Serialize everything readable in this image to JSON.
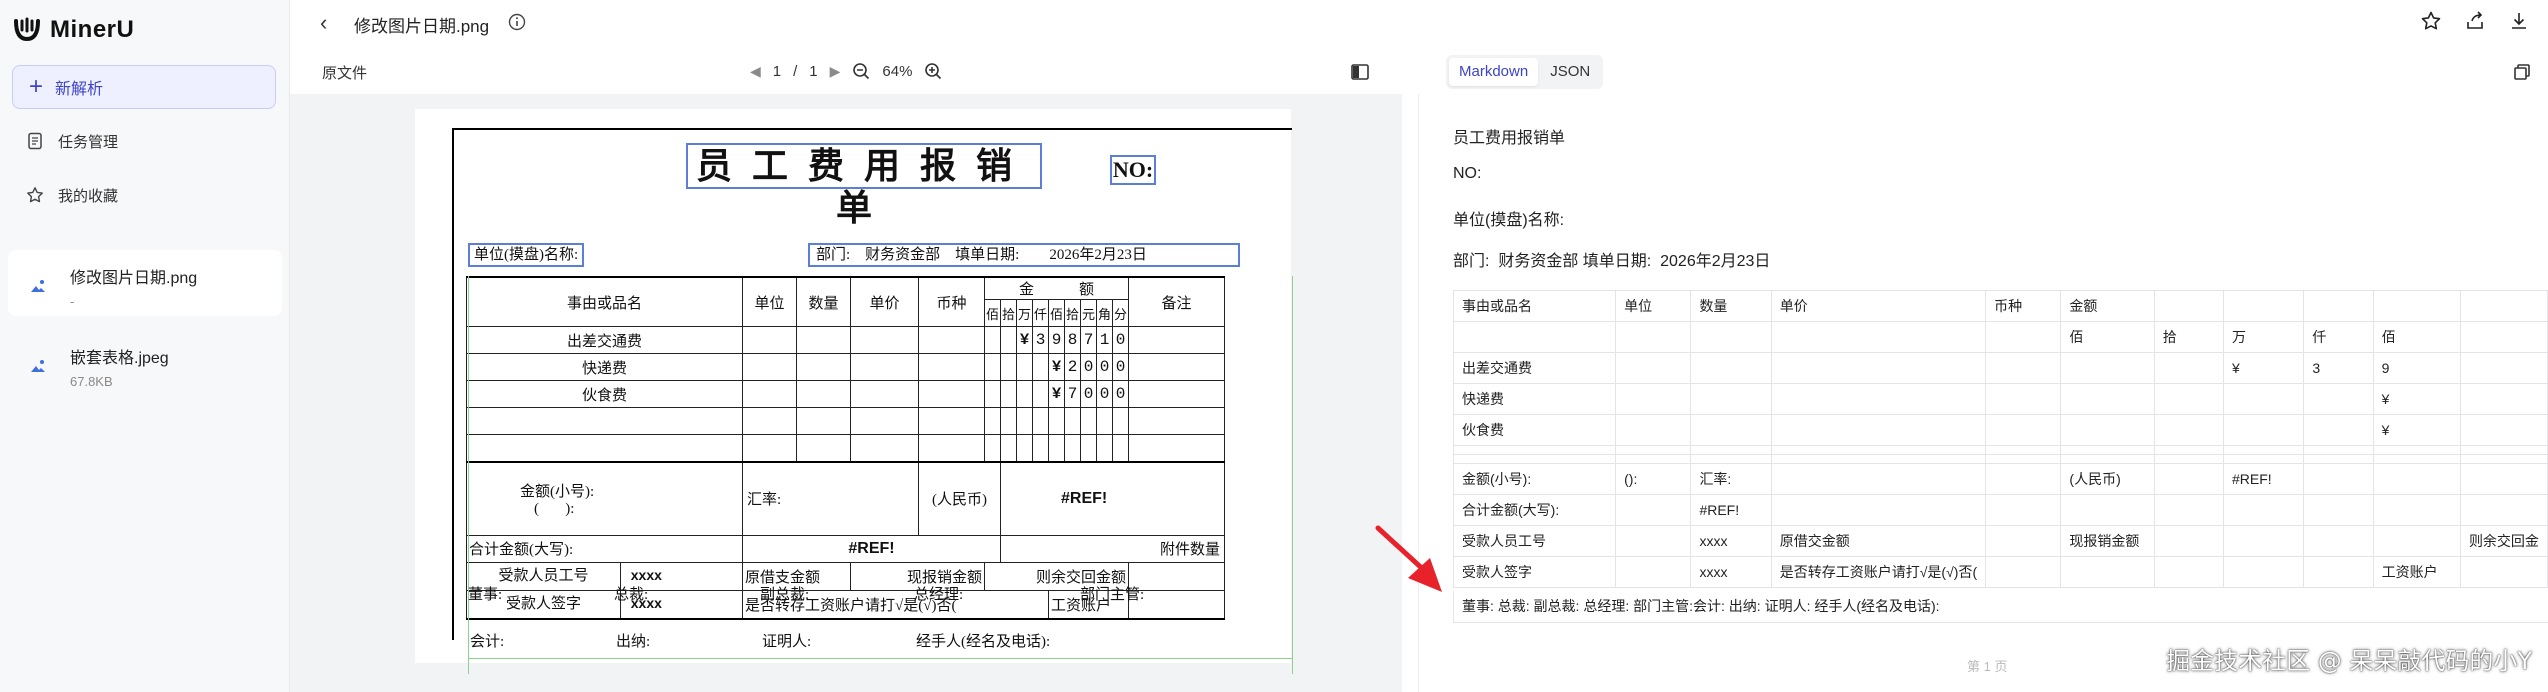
{
  "app": {
    "name": "MinerU"
  },
  "sidebar": {
    "new_button": "新解析",
    "nav": [
      {
        "label": "任务管理",
        "icon": "document-icon"
      },
      {
        "label": "我的收藏",
        "icon": "star-icon"
      }
    ],
    "files": [
      {
        "name": "修改图片日期.png",
        "sub": "-",
        "active": true
      },
      {
        "name": "嵌套表格.jpeg",
        "sub": "67.8KB",
        "active": false
      }
    ]
  },
  "header": {
    "title": "修改图片日期.png"
  },
  "viewer": {
    "source_label": "原文件",
    "page_current": "1",
    "page_sep": "/",
    "page_total": "1",
    "zoom": "64%"
  },
  "form": {
    "title": "员工费用报销单",
    "no": "NO:",
    "unit_label": "单位(摸盘)名称:",
    "dept_line": "部门:    财务资金部    填单日期:        2026年2月23日",
    "headers": {
      "item": "事由或品名",
      "unit": "单位",
      "qty": "数量",
      "price": "单价",
      "currency": "币种",
      "amount": "金            额",
      "note": "备注"
    },
    "digit_headers": [
      "佰",
      "拾",
      "万",
      "仟",
      "佰",
      "拾",
      "元",
      "角",
      "分"
    ],
    "rows": [
      {
        "item": "出差交通费",
        "digits": [
          "",
          "",
          "",
          "¥",
          "3",
          "9",
          "8",
          "7",
          "1",
          "0"
        ]
      },
      {
        "item": "快递费",
        "digits": [
          "",
          "",
          "",
          "",
          "",
          "¥",
          "2",
          "0",
          "0",
          "0"
        ]
      },
      {
        "item": "伙食费",
        "digits": [
          "",
          "",
          "",
          "",
          "",
          "¥",
          "7",
          "0",
          "0",
          "0"
        ]
      }
    ],
    "amount_small_label": "金额(小号):",
    "amount_paren": "(       ):",
    "rate_label": "汇率:",
    "rmb_label": "(人民币)",
    "ref_error": "#REF!",
    "total_big_label": "合计金额(大写):",
    "attach_label": "附件数量",
    "payee_id_label": "受款人员工号",
    "payee_id_value": "xxxx",
    "orig_loan": "原借支金额",
    "cur_reimb": "现报销金额",
    "remain_return": "则余交回金额",
    "payee_sign_label": "受款人签字",
    "payee_sign_value": "xxxx",
    "transfer_q": "是否转存工资账户请打√是(√)否(",
    "salary_acct": "工资账户",
    "sign_line1": [
      "董事:",
      "总裁:",
      "副总裁:",
      "总经理:",
      "部门主管:"
    ],
    "sign_line2": [
      "会计:",
      "出纳:",
      "证明人:",
      "经手人(经名及电话):"
    ]
  },
  "result": {
    "tabs": [
      "Markdown",
      "JSON"
    ],
    "lines": [
      "员工费用报销单",
      "NO:",
      "单位(摸盘)名称:",
      "部门:  财务资金部 填单日期:  2026年2月23日"
    ],
    "table": [
      [
        "事由或品名",
        "单位",
        "数量",
        "单价",
        "币种",
        "金额",
        "",
        "",
        "",
        "",
        ""
      ],
      [
        "",
        "",
        "",
        "",
        "",
        "佰",
        "拾",
        "万",
        "仟",
        "佰",
        ""
      ],
      [
        "出差交通费",
        "",
        "",
        "",
        "",
        "",
        "",
        "¥",
        "3",
        "9",
        ""
      ],
      [
        "快递费",
        "",
        "",
        "",
        "",
        "",
        "",
        "",
        "",
        "¥",
        ""
      ],
      [
        "伙食费",
        "",
        "",
        "",
        "",
        "",
        "",
        "",
        "",
        "¥",
        ""
      ]
    ],
    "table2": [
      [
        "金额(小号):",
        "():",
        "汇率:",
        "",
        "",
        "(人民币)",
        "",
        "#REF!",
        "",
        "",
        ""
      ],
      [
        "合计金额(大写):",
        "",
        "#REF!",
        "",
        "",
        "",
        "",
        "",
        "",
        "",
        ""
      ],
      [
        "受款人员工号",
        "",
        "xxxx",
        "原借交金额",
        "",
        "现报销金额",
        "",
        "",
        "",
        "",
        "则余交回金"
      ],
      [
        "受款人签字",
        "",
        "xxxx",
        "是否转存工资账户请打√是(√)否(",
        "",
        "",
        "",
        "",
        "",
        "工资账户",
        ""
      ]
    ],
    "footer": "董事: 总裁: 副总裁: 总经理: 部门主管:会计: 出纳: 证明人: 经手人(经名及电话):",
    "page_label": "第 1 页"
  },
  "watermark": "掘金技术社区 @ 呆呆敲代码的小Y",
  "colors": {
    "accent": "#3d44c9",
    "arrow": "#e8222a",
    "box_blue": "#5b7fd6"
  }
}
